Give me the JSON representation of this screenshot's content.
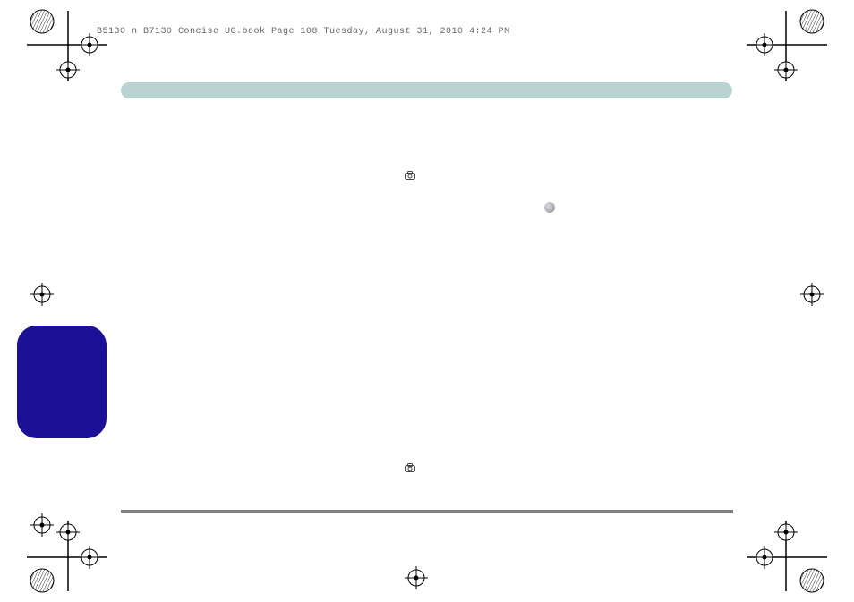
{
  "header": {
    "text": "B5130 n B7130 Concise UG.book  Page 108  Tuesday, August 31, 2010  4:24 PM"
  }
}
